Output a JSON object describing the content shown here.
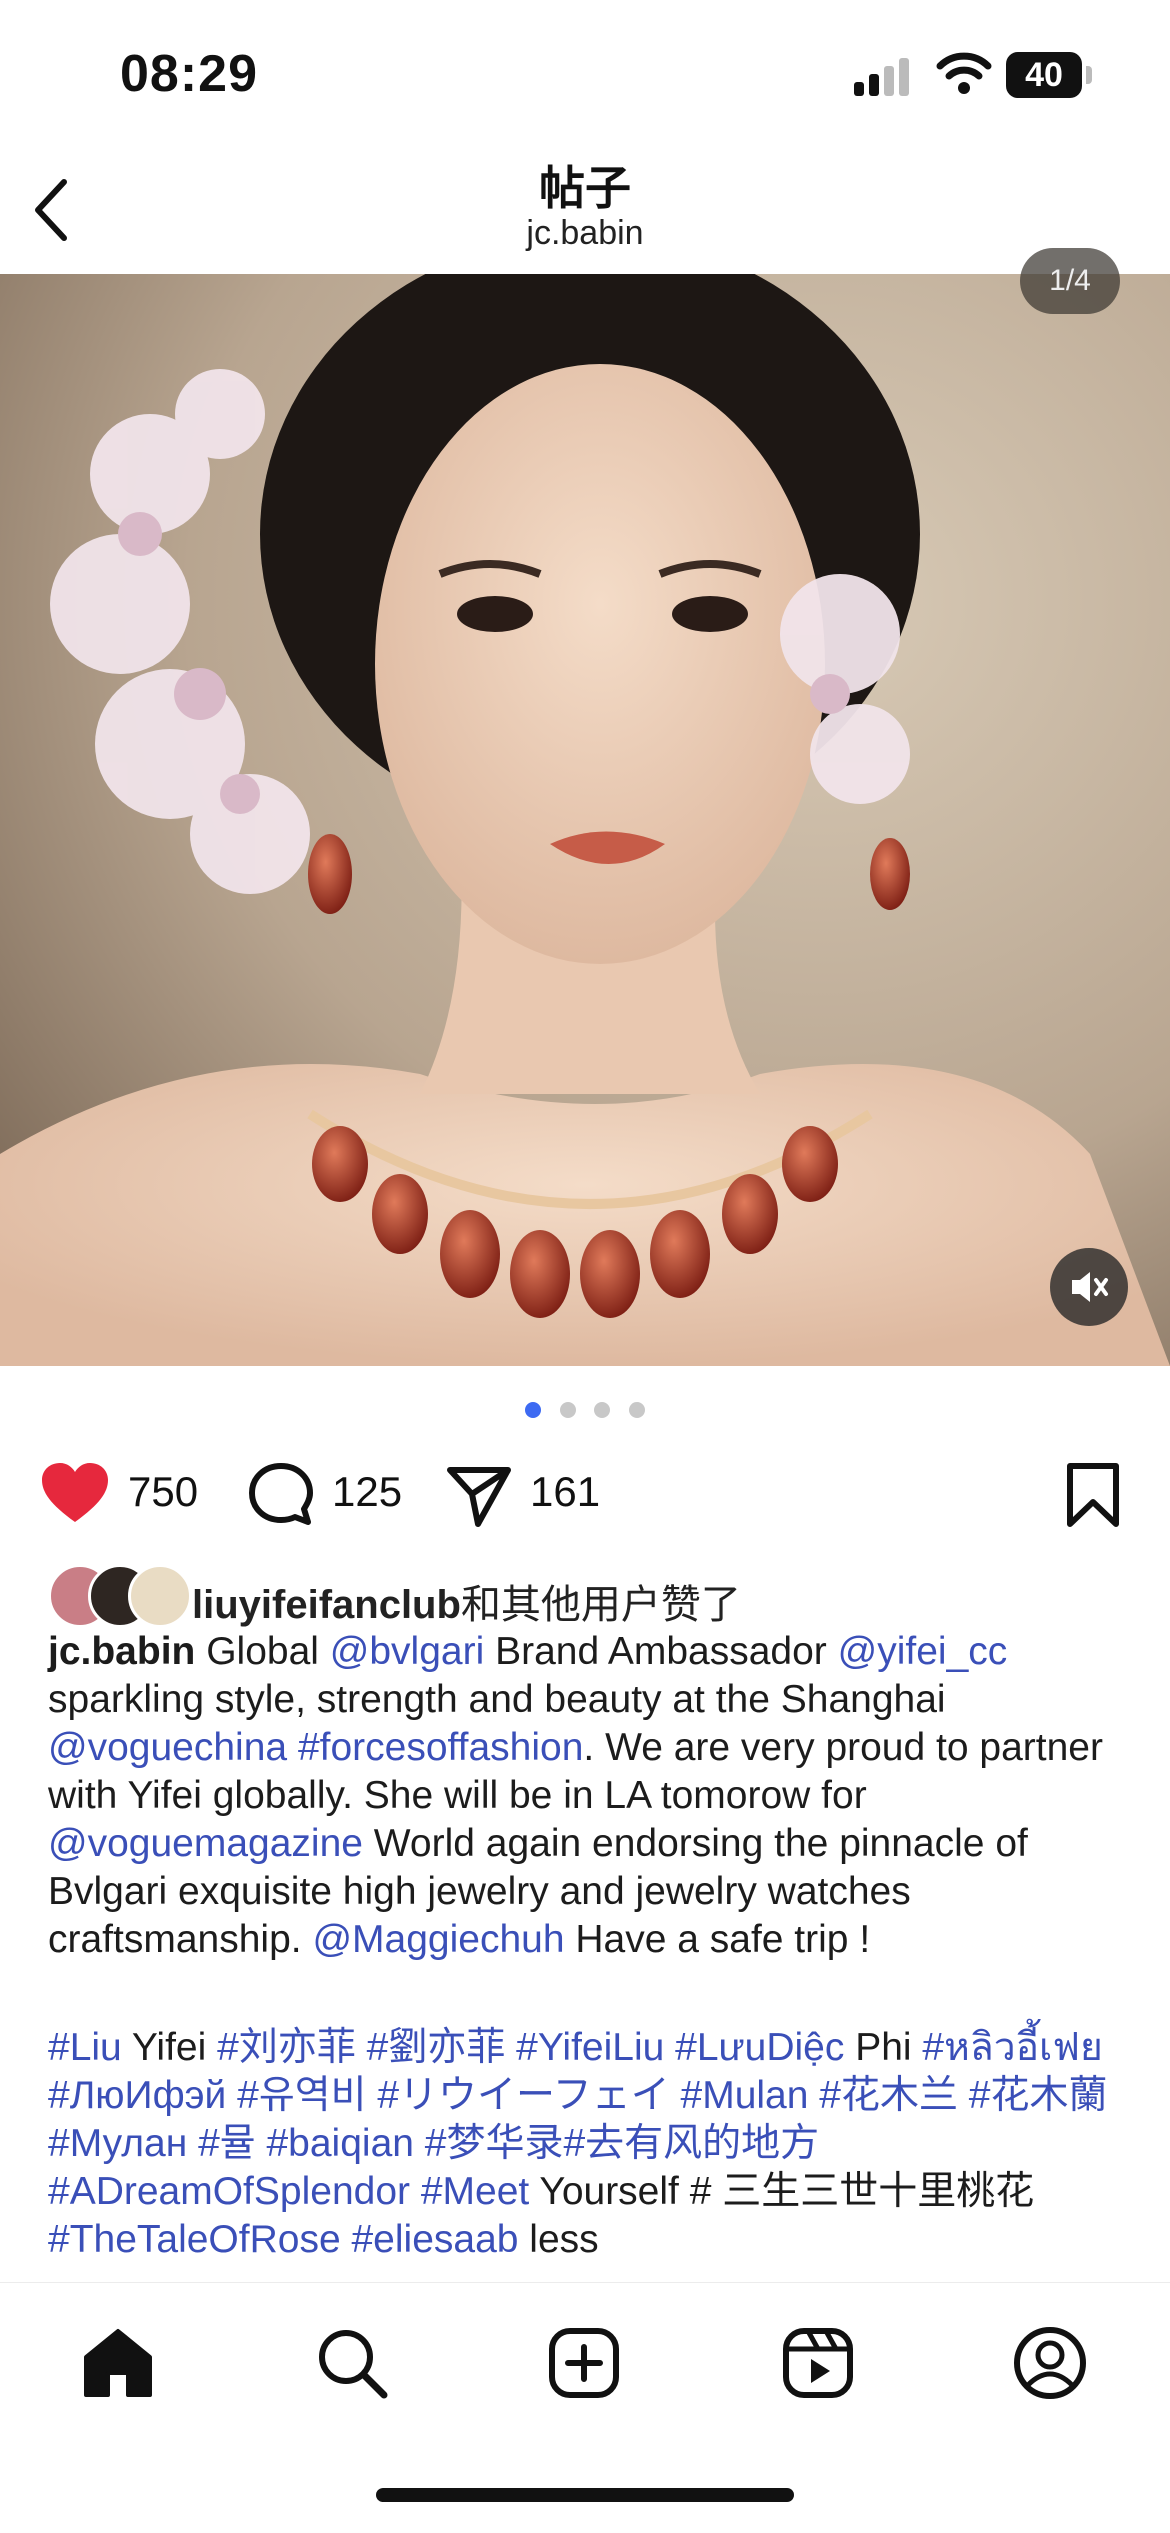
{
  "status": {
    "time": "08:29",
    "battery": "40"
  },
  "header": {
    "title": "帖子",
    "subtitle": "jc.babin"
  },
  "post": {
    "image_counter": "1/4",
    "carousel": {
      "total": 4,
      "active": 1
    },
    "likes": "750",
    "comments": "125",
    "shares": "161",
    "liked": true
  },
  "likes_line": {
    "user": "liuyifeifanclub",
    "suffix": "和其他用户赞了"
  },
  "caption": {
    "username": "jc.babin",
    "t1": " Global ",
    "m1": "@bvlgari",
    "t2": " Brand Ambassador ",
    "m2": "@yifei_cc",
    "t3": " sparkling style, strength and beauty at the Shanghai ",
    "m3": "@voguechina",
    "h1": "#forcesoffashion",
    "t4": ". We are very proud to partner with Yifei globally. She will be in LA tomorow for ",
    "m4": "@voguemagazine",
    "t5": " World again endorsing the pinnacle of Bvlgari exquisite high jewelry and jewelry watches craftsmanship. ",
    "m5": "@Maggiechuh",
    "t6": " Have a safe trip !"
  },
  "hashtags": {
    "a": "#Liu",
    "b": " Yifei ",
    "c": "#刘亦菲 #劉亦菲 #YifeiLiu #LưuDiệc",
    "d": " Phi ",
    "e": "#หลิวอี้เฟย #ЛюИфэй #유역비 #リウイーフェイ #Mulan #花木兰 #花木蘭 #Мулан #뮬 #baiqian #梦华录#去有风的地方 #ADreamOfSplendor #Meet",
    "f": " Yourself # 三生三世十里桃花 ",
    "g": "#TheTaleOfRose #eliesaab",
    "h": " less"
  },
  "tabs": [
    "home-icon",
    "search-icon",
    "create-icon",
    "reels-icon",
    "profile-icon"
  ],
  "colors": {
    "like": "#e6283d",
    "link": "#3a4fb8",
    "dot_active": "#3d6af2"
  }
}
